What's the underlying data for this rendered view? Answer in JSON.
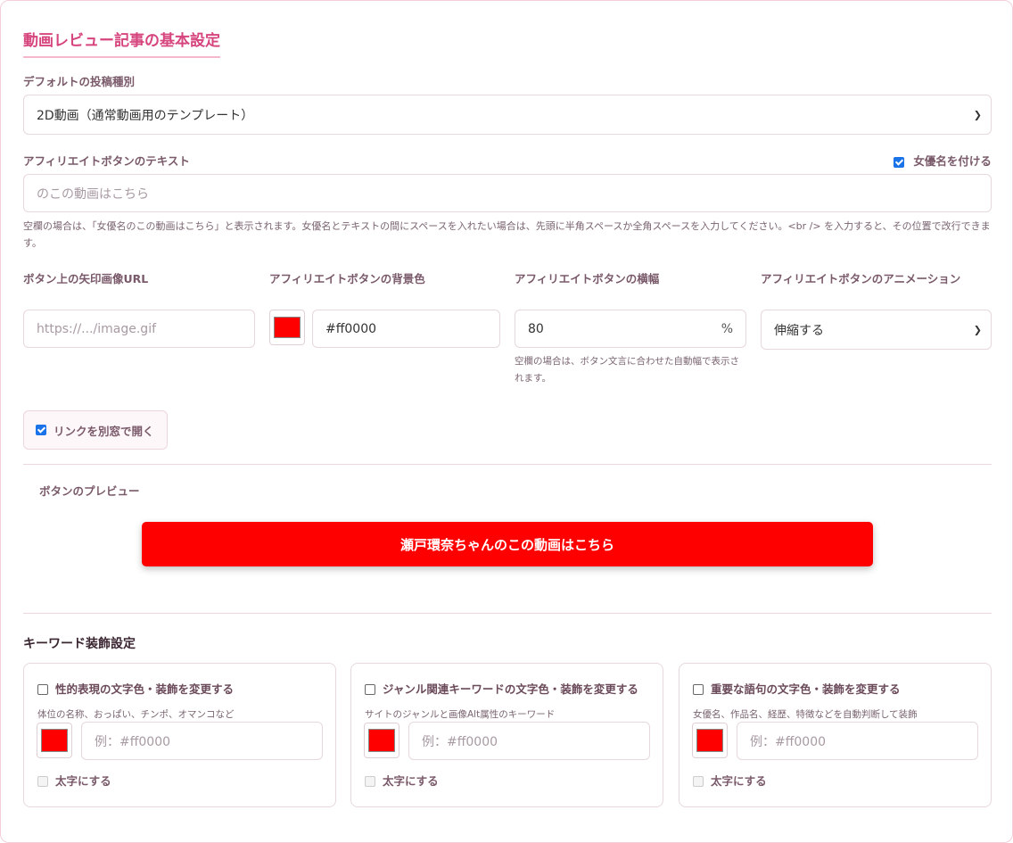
{
  "section_title": "動画レビュー記事の基本設定",
  "post_type": {
    "label": "デフォルトの投稿種別",
    "value": "2D動画（通常動画用のテンプレート）"
  },
  "affiliate_text": {
    "label": "アフィリエイトボタンのテキスト",
    "actress_checkbox_label": "女優名を付ける",
    "actress_checked": true,
    "placeholder": "のこの動画はこちら",
    "help": "空欄の場合は、「女優名のこの動画はこちら」と表示されます。女優名とテキストの間にスペースを入れたい場合は、先頭に半角スペースか全角スペースを入力してください。<br /> を入力すると、その位置で改行できます。"
  },
  "arrow_image": {
    "label": "ボタン上の矢印画像URL",
    "placeholder": "https://.../image.gif"
  },
  "bg_color": {
    "label": "アフィリエイトボタンの背景色",
    "value": "#ff0000",
    "swatch_color": "#ff0000"
  },
  "button_width": {
    "label": "アフィリエイトボタンの横幅",
    "value": "80",
    "unit": "%",
    "help": "空欄の場合は、ボタン文言に合わせた自動幅で表示されます。"
  },
  "animation": {
    "label": "アフィリエイトボタンのアニメーション",
    "value": "伸縮する"
  },
  "new_window": {
    "label": "リンクを別窓で開く",
    "checked": true
  },
  "preview": {
    "label": "ボタンのプレビュー",
    "button_text": "瀬戸環奈ちゃんのこの動画はこちら",
    "button_color": "#ff0000"
  },
  "keyword": {
    "title": "キーワード装飾設定",
    "cards": [
      {
        "title": "性的表現の文字色・装飾を変更する",
        "help": "体位の名称、おっぱい、チンポ、オマンコなど",
        "placeholder": "例：#ff0000",
        "bold_label": "太字にする"
      },
      {
        "title": "ジャンル関連キーワードの文字色・装飾を変更する",
        "help": "サイトのジャンルと画像Alt属性のキーワード",
        "placeholder": "例：#ff0000",
        "bold_label": "太字にする"
      },
      {
        "title": "重要な語句の文字色・装飾を変更する",
        "help": "女優名、作品名、経歴、特徴などを自動判断して装飾",
        "placeholder": "例：#ff0000",
        "bold_label": "太字にする"
      }
    ]
  }
}
